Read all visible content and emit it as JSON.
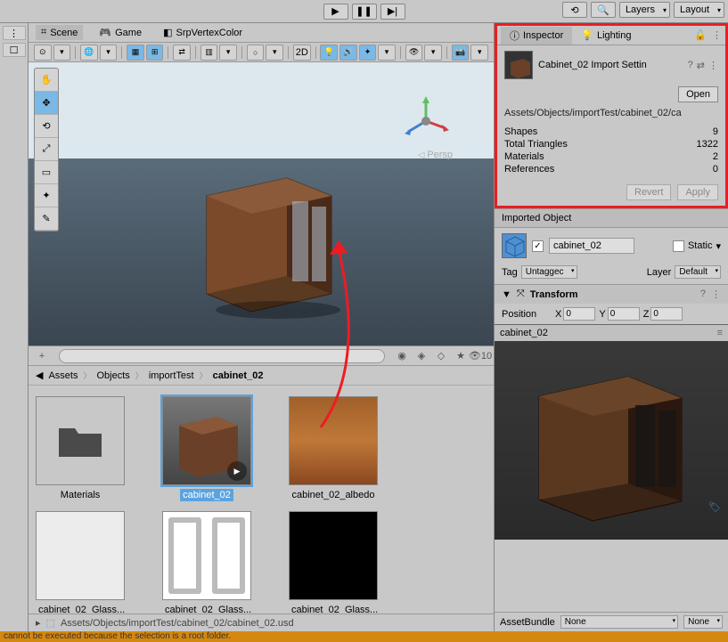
{
  "topbar": {
    "layers": "Layers",
    "layout": "Layout"
  },
  "tabs": {
    "scene": "Scene",
    "game": "Game",
    "srp": "SrpVertexColor"
  },
  "viewport": {
    "mode2d": "2D",
    "persp": "Persp"
  },
  "inspector": {
    "tab_inspector": "Inspector",
    "tab_lighting": "Lighting",
    "title": "Cabinet_02 Import Settin",
    "open": "Open",
    "path": "Assets/Objects/importTest/cabinet_02/ca",
    "stats": {
      "shapes_label": "Shapes",
      "shapes_val": "9",
      "tris_label": "Total Triangles",
      "tris_val": "1322",
      "mats_label": "Materials",
      "mats_val": "2",
      "refs_label": "References",
      "refs_val": "0"
    },
    "revert": "Revert",
    "apply": "Apply",
    "imported": "Imported Object",
    "obj_name": "cabinet_02",
    "static": "Static",
    "tag_label": "Tag",
    "tag_val": "Untaggec",
    "layer_label": "Layer",
    "layer_val": "Default",
    "transform": "Transform",
    "position": "Position",
    "x": "X",
    "y": "Y",
    "z": "Z",
    "zero": "0",
    "preview_name": "cabinet_02",
    "assetbundle": "AssetBundle",
    "none": "None",
    "none2": "None"
  },
  "breadcrumb": {
    "assets": "Assets",
    "objects": "Objects",
    "importtest": "importTest",
    "cabinet": "cabinet_02"
  },
  "project": {
    "count": "10",
    "path": "Assets/Objects/importTest/cabinet_02/cabinet_02.usd"
  },
  "assets": {
    "materials": "Materials",
    "cab": "cabinet_02",
    "albedo": "cabinet_02_albedo",
    "glass1": "cabinet_02_Glass...",
    "glass2": "cabinet_02_Glass...",
    "glass3": "cabinet_02_Glass..."
  },
  "warn": "cannot be executed because the selection is a root folder."
}
